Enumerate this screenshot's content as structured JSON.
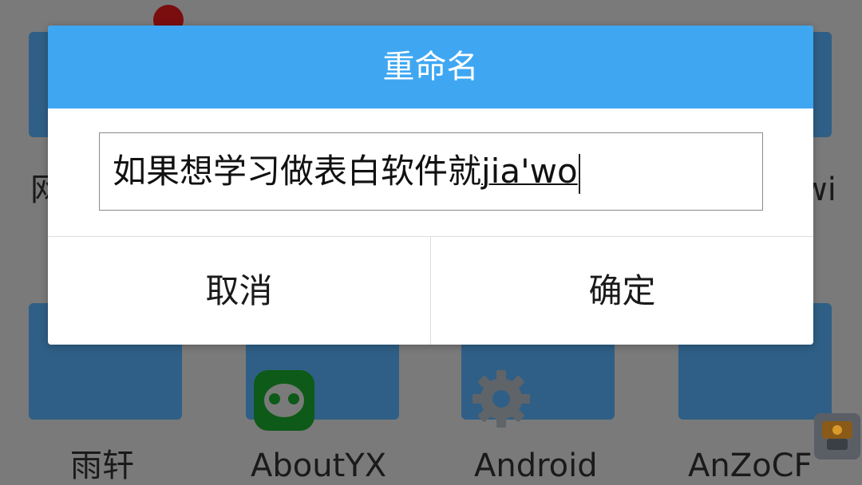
{
  "launcher": {
    "left_partial_label": "网",
    "right_partial_label": "wi",
    "apps": [
      {
        "label": "雨轩",
        "icon": "blank-tile"
      },
      {
        "label": "AboutYX",
        "icon": "green-chat-icon"
      },
      {
        "label": "Android",
        "icon": "gear-icon"
      },
      {
        "label": "AnZoCF",
        "icon": "blank-tile"
      }
    ]
  },
  "dialog": {
    "title": "重命名",
    "input_value": "如果想学习做表白软件就",
    "input_composing": "jia'wo",
    "cancel_label": "取消",
    "confirm_label": "确定"
  },
  "colors": {
    "header": "#3fa7f2",
    "dim_overlay": "#7a7a7a",
    "tile": "#2f5f86"
  }
}
